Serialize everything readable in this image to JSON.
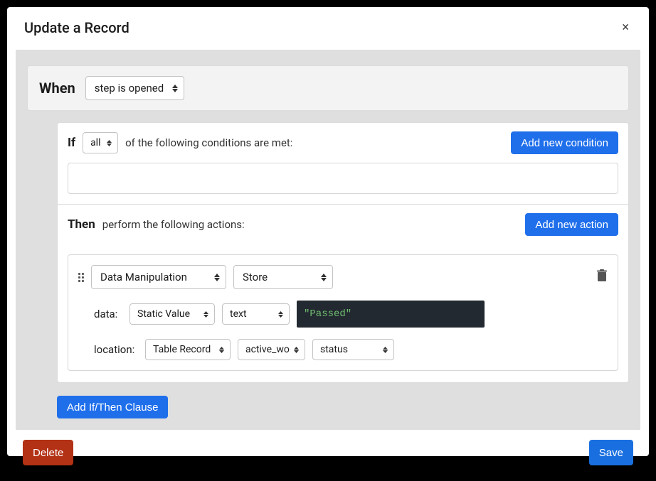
{
  "modal": {
    "title": "Update a Record",
    "close_label": "×"
  },
  "when": {
    "label": "When",
    "trigger": "step is opened"
  },
  "if": {
    "label": "If",
    "match": "all",
    "suffix": "of the following conditions are met:",
    "add_button": "Add new condition"
  },
  "then": {
    "label": "Then",
    "subtitle": "perform the following actions:",
    "add_button": "Add new action",
    "action": {
      "category": "Data Manipulation",
      "operation": "Store",
      "data_label": "data:",
      "data_source": "Static Value",
      "data_type": "text",
      "data_value": "\"Passed\"",
      "location_label": "location:",
      "location_kind": "Table Record",
      "location_record": "active_wo",
      "location_field": "status"
    }
  },
  "add_clause_label": "Add If/Then Clause",
  "footer": {
    "delete": "Delete",
    "save": "Save"
  }
}
